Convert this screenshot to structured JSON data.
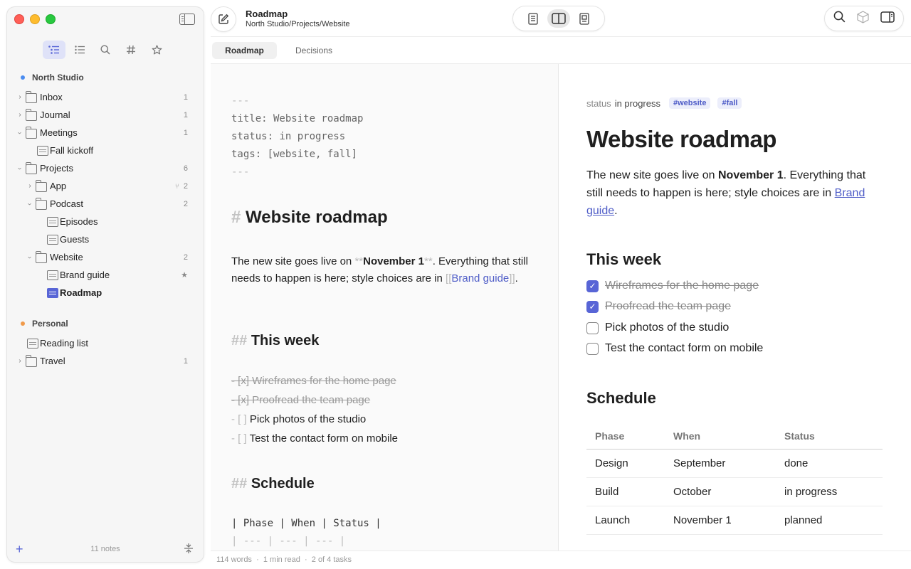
{
  "sidebar": {
    "groups": [
      {
        "label": "North Studio",
        "color": "#4a8cf0"
      },
      {
        "label": "Personal",
        "color": "#f09a4a"
      }
    ],
    "items": [
      {
        "label": "Inbox",
        "count": "1"
      },
      {
        "label": "Journal",
        "count": "1"
      },
      {
        "label": "Meetings",
        "count": "1"
      },
      {
        "label": "Fall kickoff"
      },
      {
        "label": "Projects",
        "count": "6"
      },
      {
        "label": "App",
        "count": "2"
      },
      {
        "label": "Podcast",
        "count": "2"
      },
      {
        "label": "Episodes"
      },
      {
        "label": "Guests"
      },
      {
        "label": "Website",
        "count": "2"
      },
      {
        "label": "Brand guide"
      },
      {
        "label": "Roadmap"
      },
      {
        "label": "Reading list"
      },
      {
        "label": "Travel",
        "count": "1"
      }
    ],
    "footer_notes": "11 notes",
    "accent": "#5865d6"
  },
  "header": {
    "title": "Roadmap",
    "path": "North Studio/Projects/Website"
  },
  "tabs": [
    "Roadmap",
    "Decisions"
  ],
  "editor": {
    "frontmatter": [
      "---",
      "title: Website roadmap",
      "status: in progress",
      "tags: [website, fall]",
      "---"
    ],
    "h1_mark": "#",
    "h1": "Website roadmap",
    "p_before": "The new site goes live on ",
    "bold_mark": "**",
    "bold": "November 1",
    "p_middle": ". Everything that still needs to happen is here; style choices are in ",
    "link_open": "[[",
    "link_text": "Brand guide",
    "link_close": "]]",
    "p_end": ".",
    "h2_mark": "##",
    "h2_week": "This week",
    "tasks": [
      {
        "prefix": "- [x]",
        "text": "Wireframes for the home page"
      },
      {
        "prefix": "- [x]",
        "text": "Proofread the team page"
      },
      {
        "prefix": "- [ ]",
        "text": "Pick photos of the studio"
      },
      {
        "prefix": "- [ ]",
        "text": "Test the contact form on mobile"
      }
    ],
    "h2_schedule": "Schedule",
    "table_lines": [
      "| Phase | When | Status |",
      "| --- | --- | --- |"
    ]
  },
  "status_bar": {
    "words": "114 words",
    "read": "1 min read",
    "tasks": "2 of 4 tasks",
    "sep": "·"
  },
  "preview": {
    "status_key": "status",
    "status_value": "in progress",
    "tags": [
      "#website",
      "#fall"
    ],
    "h1": "Website roadmap",
    "p_before": "The new site goes live on ",
    "bold": "November 1",
    "p_middle": ". Everything that still needs to happen is here; style choices are in ",
    "link_text": "Brand guide",
    "p_end": ".",
    "h2_week": "This week",
    "tasks": [
      {
        "text": "Wireframes for the home page",
        "done": true
      },
      {
        "text": "Proofread the team page",
        "done": true
      },
      {
        "text": "Pick photos of the studio",
        "done": false
      },
      {
        "text": "Test the contact form on mobile",
        "done": false
      }
    ],
    "h2_schedule": "Schedule",
    "table": {
      "headers": [
        "Phase",
        "When",
        "Status"
      ],
      "rows": [
        [
          "Design",
          "September",
          "done"
        ],
        [
          "Build",
          "October",
          "in progress"
        ],
        [
          "Launch",
          "November 1",
          "planned"
        ]
      ]
    }
  },
  "icons": {
    "compose": "compose-icon",
    "search": "search-icon",
    "cube": "cube-icon",
    "inspector": "inspector-toggle-icon"
  }
}
